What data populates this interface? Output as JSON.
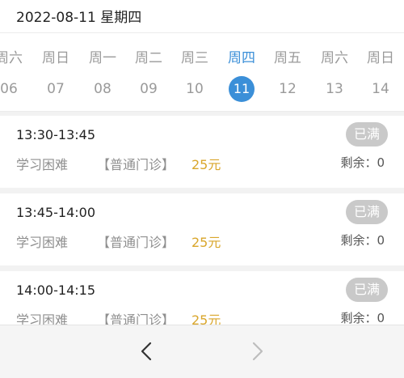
{
  "header": {
    "date_text": "2022-08-11 星期四"
  },
  "calendar": {
    "days": [
      {
        "weekday": "周六",
        "day": "06",
        "active": false
      },
      {
        "weekday": "周日",
        "day": "07",
        "active": false
      },
      {
        "weekday": "周一",
        "day": "08",
        "active": false
      },
      {
        "weekday": "周二",
        "day": "09",
        "active": false
      },
      {
        "weekday": "周三",
        "day": "10",
        "active": false
      },
      {
        "weekday": "周四",
        "day": "11",
        "active": true
      },
      {
        "weekday": "周五",
        "day": "12",
        "active": false
      },
      {
        "weekday": "周六",
        "day": "13",
        "active": false
      },
      {
        "weekday": "周日",
        "day": "14",
        "active": false
      }
    ]
  },
  "slots": [
    {
      "time": "13:30-13:45",
      "title": "学习困难",
      "type": "【普通门诊】",
      "price": "25元",
      "status": "已满",
      "remaining": "剩余：0"
    },
    {
      "time": "13:45-14:00",
      "title": "学习困难",
      "type": "【普通门诊】",
      "price": "25元",
      "status": "已满",
      "remaining": "剩余：0"
    },
    {
      "time": "14:00-14:15",
      "title": "学习困难",
      "type": "【普通门诊】",
      "price": "25元",
      "status": "已满",
      "remaining": "剩余：0"
    }
  ],
  "footer": {
    "prev_icon": "chevron-left-icon",
    "next_icon": "chevron-right-icon"
  },
  "colors": {
    "accent": "#3b8fd8",
    "price": "#d9a62b",
    "badge": "#c9c9c9"
  }
}
